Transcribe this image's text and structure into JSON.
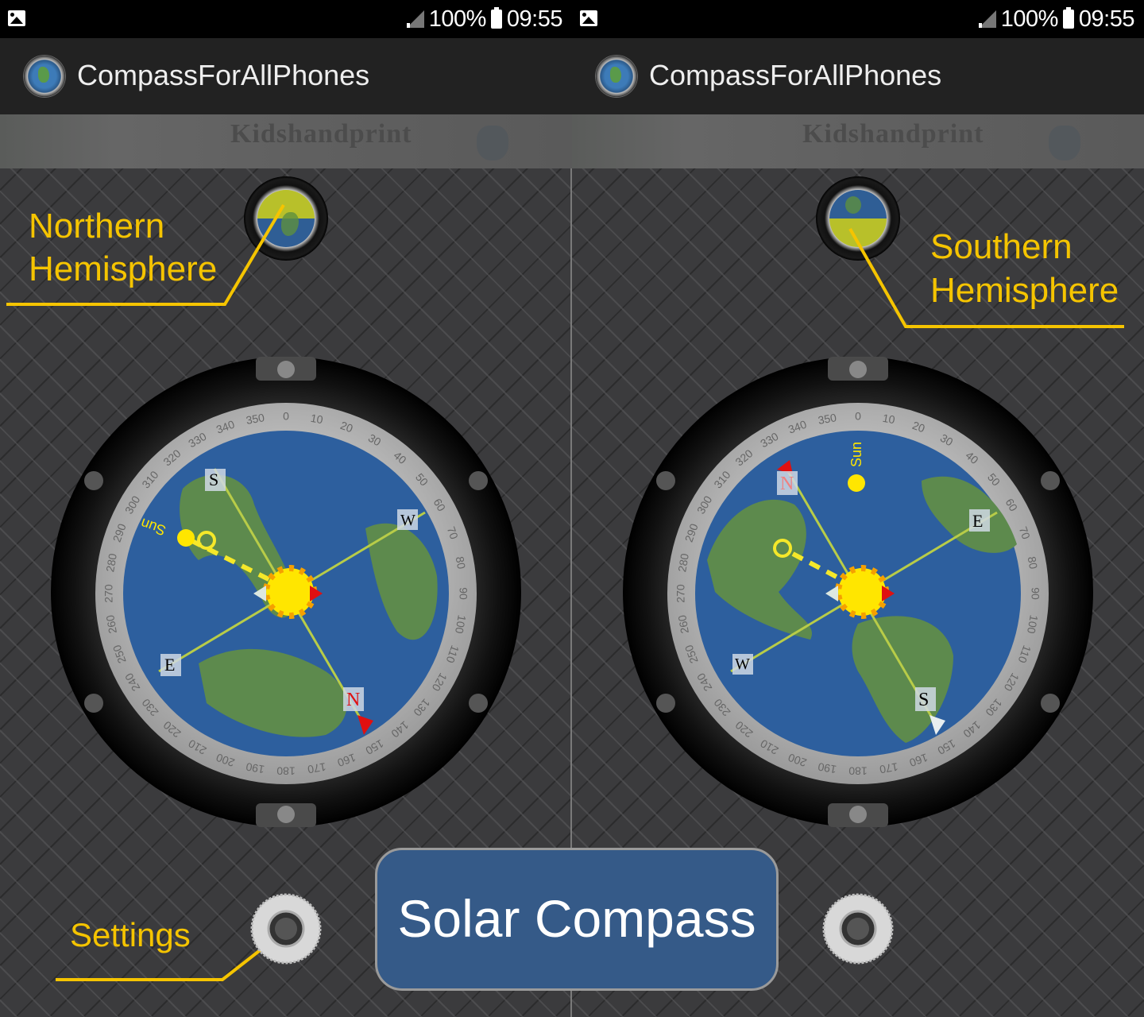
{
  "status_bar": {
    "battery": "100%",
    "time": "09:55"
  },
  "app_bar": {
    "title": "CompassForAllPhones"
  },
  "ad_banner": {
    "text": "Kidshandprint"
  },
  "left_pane": {
    "hemisphere_label_line1": "Northern",
    "hemisphere_label_line2": "Hemisphere",
    "settings_label": "Settings",
    "compass": {
      "cardinals": {
        "top_left": "S",
        "top_right": "W",
        "bottom_left": "E",
        "bottom_right": "N"
      },
      "sun_label": "Sun"
    }
  },
  "right_pane": {
    "hemisphere_label_line1": "Southern",
    "hemisphere_label_line2": "Hemisphere",
    "compass": {
      "cardinals": {
        "top_left": "N",
        "top_right": "E",
        "bottom_left": "W",
        "bottom_right": "S"
      },
      "sun_label": "Sun"
    }
  },
  "dial_ticks": [
    "0",
    "10",
    "20",
    "30",
    "40",
    "50",
    "60",
    "70",
    "80",
    "90",
    "100",
    "110",
    "120",
    "130",
    "140",
    "150",
    "160",
    "170",
    "180",
    "190",
    "200",
    "210",
    "220",
    "230",
    "240",
    "250",
    "260",
    "270",
    "280",
    "290",
    "300",
    "310",
    "320",
    "330",
    "340",
    "350"
  ],
  "center_caption": "Solar Compass",
  "colors": {
    "accent_yellow": "#f5c400",
    "caption_blue": "#355a88",
    "north_red": "#e01010"
  }
}
